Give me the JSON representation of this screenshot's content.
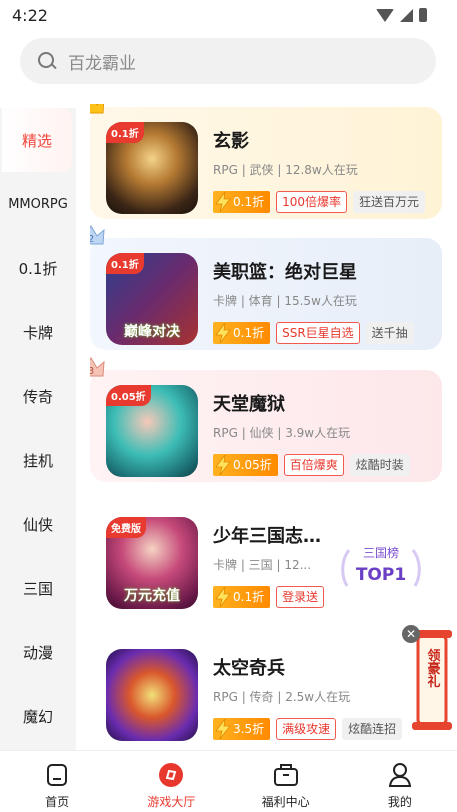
{
  "status": {
    "time": "4:22"
  },
  "search": {
    "placeholder": "百龙霸业"
  },
  "sidebar": {
    "items": [
      {
        "label": "精选",
        "active": true
      },
      {
        "label": "MMORPG"
      },
      {
        "label": "0.1折"
      },
      {
        "label": "卡牌"
      },
      {
        "label": "传奇"
      },
      {
        "label": "挂机"
      },
      {
        "label": "仙侠"
      },
      {
        "label": "三国"
      },
      {
        "label": "动漫"
      },
      {
        "label": "魔幻"
      }
    ]
  },
  "games": [
    {
      "rank": "1",
      "corner": "0.1折",
      "name": "玄影",
      "meta": "RPG | 武侠 | 12.8w人在玩",
      "discount": "0.1折",
      "tag_red": "100倍爆率",
      "tag_gray": "狂送百万元"
    },
    {
      "rank": "2",
      "corner": "0.1折",
      "icon_caption": "巅峰对决",
      "name": "美职篮：绝对巨星",
      "meta": "卡牌 | 体育 | 15.5w人在玩",
      "discount": "0.1折",
      "tag_red": "SSR巨星自选",
      "tag_gray": "送千抽"
    },
    {
      "rank": "3",
      "corner": "0.05折",
      "name": "天堂魔狱",
      "meta": "RPG | 仙侠 | 3.9w人在玩",
      "discount": "0.05折",
      "tag_red": "百倍爆爽",
      "tag_gray": "炫酷时装"
    },
    {
      "corner": "免费版",
      "icon_caption": "万元充值",
      "name": "少年三国志…",
      "meta": "卡牌 | 三国 | 12...",
      "discount": "0.1折",
      "tag_red": "登录送"
    },
    {
      "name": "太空奇兵",
      "meta": "RPG | 传奇 | 2.5w人在玩",
      "discount": "3.5折",
      "tag_red": "满级攻速",
      "tag_gray": "炫酷连招"
    }
  ],
  "floating": {
    "top1_title": "三国榜",
    "top1_label": "TOP1",
    "gift_label": "领豪礼"
  },
  "tabbar": [
    {
      "label": "首页"
    },
    {
      "label": "游戏大厅",
      "active": true
    },
    {
      "label": "福利中心"
    },
    {
      "label": "我的"
    }
  ],
  "colors": {
    "accent": "#e8382d",
    "discount_orange": "#ff9a0e"
  }
}
